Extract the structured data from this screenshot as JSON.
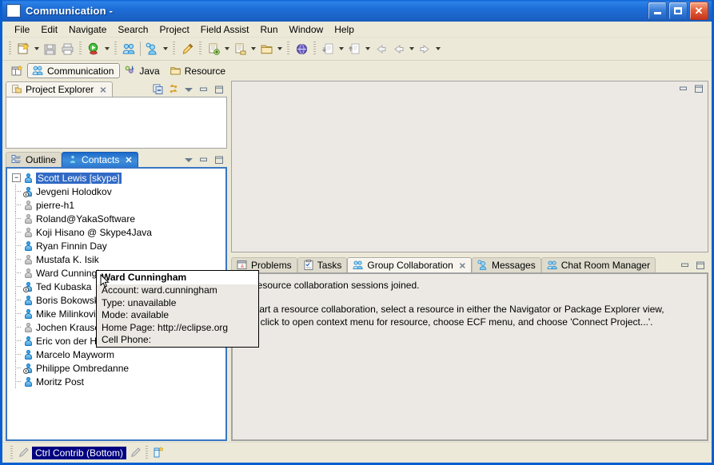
{
  "window": {
    "title": "Communication -",
    "icon": "window-icon",
    "buttons": {
      "minimize": "minimize",
      "maximize": "maximize",
      "close": "close"
    }
  },
  "menubar": {
    "items": [
      "File",
      "Edit",
      "Navigate",
      "Search",
      "Project",
      "Field Assist",
      "Run",
      "Window",
      "Help"
    ]
  },
  "toolbar": {
    "groups": [
      {
        "items": [
          {
            "name": "new-wizard-icon",
            "arrow": true
          },
          {
            "name": "save-icon",
            "arrow": false
          },
          {
            "name": "print-icon",
            "arrow": false
          }
        ]
      },
      {
        "items": [
          {
            "name": "run-icon",
            "arrow": true
          }
        ]
      },
      {
        "items": [
          {
            "name": "group-collaboration-icon",
            "arrow": false
          },
          {
            "name": "add-contact-icon",
            "arrow": true
          }
        ]
      },
      {
        "items": [
          {
            "name": "pencil-icon",
            "arrow": false
          }
        ]
      },
      {
        "items": [
          {
            "name": "new-file-add-icon",
            "arrow": true
          },
          {
            "name": "new-file-icon",
            "arrow": true
          },
          {
            "name": "new-folder-icon",
            "arrow": true
          }
        ]
      },
      {
        "items": [
          {
            "name": "globe-icon",
            "arrow": false
          }
        ]
      },
      {
        "items": [
          {
            "name": "import-icon",
            "arrow": true
          },
          {
            "name": "export-icon",
            "arrow": true
          }
        ]
      },
      {
        "items": [
          {
            "name": "back-annotation-icon",
            "arrow": false
          },
          {
            "name": "back-icon",
            "arrow": true
          },
          {
            "name": "forward-icon",
            "arrow": true
          }
        ]
      }
    ]
  },
  "perspective_bar": {
    "open_perspective": "open-perspective-icon",
    "tabs": [
      {
        "label": "Communication",
        "icon": "group-collaboration-icon",
        "active": true
      },
      {
        "label": "Java",
        "icon": "java-icon",
        "active": false
      },
      {
        "label": "Resource",
        "icon": "folder-icon",
        "active": false
      }
    ]
  },
  "project_explorer": {
    "tab_label": "Project Explorer",
    "tab_icon": "project-explorer-icon",
    "close_icon": "close-icon",
    "toolbar": [
      "collapse-all-icon",
      "link-with-editor-icon",
      "view-menu-icon",
      "minimize-icon",
      "maximize-icon"
    ]
  },
  "outline_contacts": {
    "tabs": [
      {
        "label": "Outline",
        "icon": "outline-icon",
        "active": false,
        "closable": false
      },
      {
        "label": "Contacts",
        "icon": "contacts-icon",
        "active": true,
        "closable": true
      }
    ],
    "toolbar": [
      "view-menu-icon",
      "minimize-icon",
      "maximize-icon"
    ],
    "tree": {
      "root": {
        "label": "Scott Lewis [skype]",
        "status": "online",
        "selected": true,
        "expanded": true
      },
      "children": [
        {
          "label": "Jevgeni Holodkov",
          "status": "online",
          "away": true
        },
        {
          "label": "pierre-h1",
          "status": "offline",
          "away": false
        },
        {
          "label": "Roland@YakaSoftware",
          "status": "offline",
          "away": false
        },
        {
          "label": "Koji Hisano @ Skype4Java",
          "status": "offline",
          "away": false
        },
        {
          "label": "Ryan Finnin Day",
          "status": "online",
          "away": false
        },
        {
          "label": "Mustafa K. Isik",
          "status": "offline",
          "away": false
        },
        {
          "label": "Ward Cunningham",
          "status": "offline",
          "away": false
        },
        {
          "label": "Ted Kubaska",
          "status": "online",
          "away": true
        },
        {
          "label": "Boris Bokowski",
          "status": "online",
          "away": false
        },
        {
          "label": "Mike Milinkovich",
          "status": "online",
          "away": false
        },
        {
          "label": "Jochen Krause",
          "status": "offline",
          "away": false
        },
        {
          "label": "Eric von der Heyden",
          "status": "online",
          "away": false
        },
        {
          "label": "Marcelo Mayworm",
          "status": "online",
          "away": false
        },
        {
          "label": "Philippe Ombredanne",
          "status": "online",
          "away": true
        },
        {
          "label": "Moritz Post",
          "status": "online",
          "away": false
        }
      ]
    }
  },
  "tooltip": {
    "title": "Ward Cunningham",
    "lines": [
      "Account: ward.cunningham",
      "Type: unavailable",
      "Mode: available",
      "Home Page: http://eclipse.org",
      "Cell Phone:"
    ]
  },
  "bottom_stack": {
    "tabs": [
      {
        "label": "Problems",
        "icon": "problems-icon",
        "active": false,
        "closable": false
      },
      {
        "label": "Tasks",
        "icon": "tasks-icon",
        "active": false,
        "closable": false
      },
      {
        "label": "Group Collaboration",
        "icon": "group-collaboration-icon",
        "active": true,
        "closable": true
      },
      {
        "label": "Messages",
        "icon": "messages-icon",
        "active": false,
        "closable": false
      },
      {
        "label": "Chat Room Manager",
        "icon": "chat-room-icon",
        "active": false,
        "closable": false
      }
    ],
    "toolbar": [
      "minimize-icon",
      "maximize-icon"
    ],
    "content": {
      "line1": "No resource collaboration sessions joined.",
      "line2": "To start a resource collaboration, select a resource in either the Navigator or Package Explorer view,",
      "line3": "right click to open context menu for resource, choose ECF menu, and choose 'Connect Project...'."
    }
  },
  "statusbar": {
    "left_icon": "pencil-disabled-icon",
    "field_value": "Ctrl Contrib (Bottom)",
    "right_icon": "pencil-disabled-icon",
    "far_icon": "contrib-icon"
  }
}
